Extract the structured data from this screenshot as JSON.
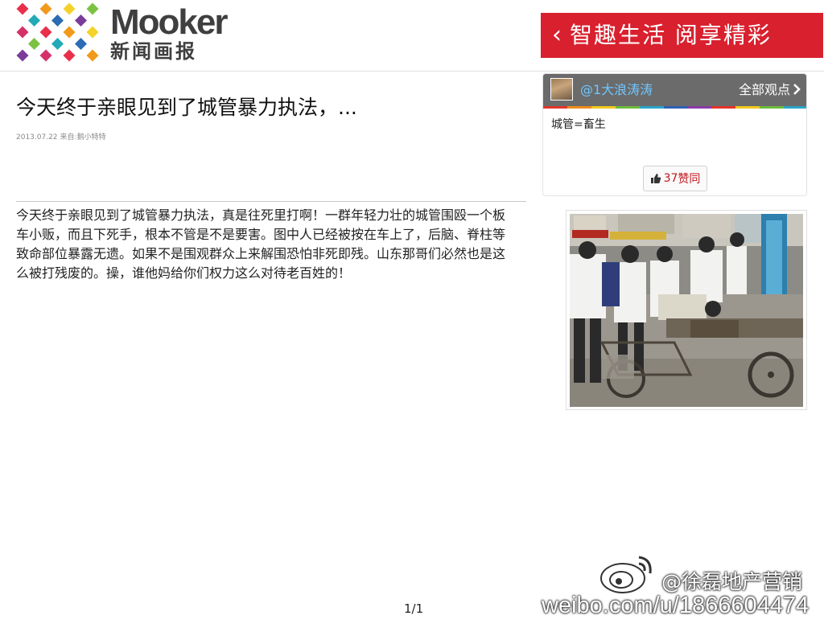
{
  "header": {
    "brand_en": "Mooker",
    "brand_cn": "新闻画报",
    "banner": {
      "chevron": "‹",
      "slogan": "智趣生活 阅享精彩",
      "color": "#d9202e"
    }
  },
  "article": {
    "title": "今天终于亲眼见到了城管暴力执法，...",
    "date": "2013.07.22",
    "source_prefix": "来自:",
    "source": "鹅小特特",
    "body": "今天终于亲眼见到了城管暴力执法，真是往死里打啊！一群年轻力壮的城管围殴一个板车小贩，而且下死手，根本不管是不是要害。图中人已经被按在车上了，后脑、脊柱等致命部位暴露无遗。如果不是围观群众上来解围恐怕非死即残。山东那哥们必然也是这么被打残废的。操，谁他妈给你们权力这么对待老百姓的！"
  },
  "comment_card": {
    "user": "@1大浪涛涛",
    "all_views": "全部观点",
    "all_views_icon": "chevron-right-icon",
    "comment": "城管=畜生",
    "like_icon": "thumbs-up-icon",
    "like_count": "37",
    "like_label": "赞同",
    "strip_colors": [
      "#e4342c",
      "#f08c1a",
      "#f2c81e",
      "#6dbb3b",
      "#2aa6c8",
      "#2f5fb3",
      "#8a3ba8",
      "#e4342c",
      "#f2c81e",
      "#6dbb3b",
      "#2aa6c8"
    ]
  },
  "pager": {
    "text": "1/1"
  },
  "watermark": {
    "name": "@徐磊地产营销",
    "url": "weibo.com/u/1866604474",
    "icon": "weibo-logo-icon"
  }
}
